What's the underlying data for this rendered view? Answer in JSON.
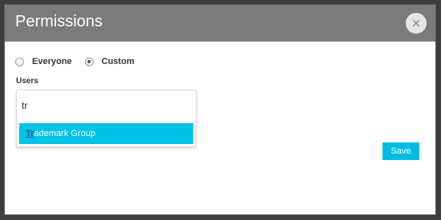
{
  "dialog": {
    "title": "Permissions",
    "close_icon": "close-icon"
  },
  "visibility": {
    "options": [
      {
        "label": "Everyone",
        "checked": false
      },
      {
        "label": "Custom",
        "checked": true
      }
    ]
  },
  "users": {
    "label": "Users",
    "input_value": "tr",
    "suggestions": [
      {
        "match": "Tr",
        "rest": "ademark Group"
      }
    ]
  },
  "actions": {
    "save_label": "Save"
  },
  "colors": {
    "header": "#7b7b7b",
    "accent": "#00c3e6"
  }
}
